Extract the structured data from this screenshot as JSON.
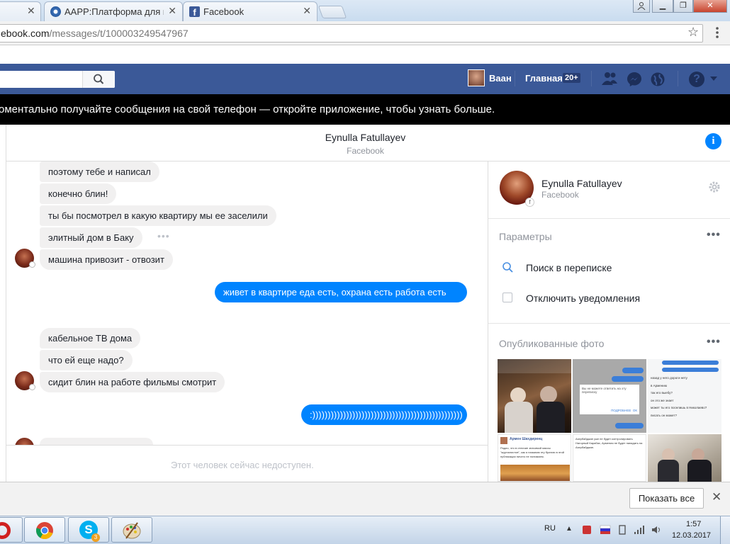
{
  "browser": {
    "tabs": [
      {
        "label": "AAPP:Платформа для м"
      },
      {
        "label": "Facebook"
      }
    ],
    "url_host": "ebook.com",
    "url_path": "/messages/t/100003249547967"
  },
  "fb_nav": {
    "user": "Ваан",
    "home": "Главная",
    "home_badge": "20+",
    "help": "?"
  },
  "banner": {
    "text": "оментально получайте сообщения на свой телефон — откройте приложение, чтобы узнать больше."
  },
  "conversation": {
    "name": "Eynulla Fatullayev",
    "subtitle": "Facebook",
    "messages": [
      {
        "text": "поэтому тебе и написал"
      },
      {
        "text": "конечно блин!"
      },
      {
        "text": "ты бы посмотрел в какую квартиру мы ее заселили"
      },
      {
        "text": "элитный дом в Баку"
      },
      {
        "text": "машина привозит - отвозит"
      },
      {
        "text": "живет в квартире  еда есть, охрана есть работа есть"
      },
      {
        "text": "кабельное ТВ дома"
      },
      {
        "text": "что ей еще надо?"
      },
      {
        "text": "сидит блин на работе фильмы смотрит"
      },
      {
        "text": ":)))))))))))))))))))))))))))))))))))))))))))))))))"
      }
    ],
    "composer_placeholder": "Этот человек сейчас недоступен."
  },
  "sidebar": {
    "name": "Eynulla Fatullayev",
    "subtitle": "Facebook",
    "params_title": "Параметры",
    "search_label": "Поиск в переписке",
    "mute_label": "Отключить уведомления",
    "photos_title": "Опубликованные фото",
    "photo_texts": {
      "p2_dialog": "Вы не можете ответить на эту переписку",
      "p2_btn1": "ПОДРОБНЕЕ",
      "p2_btn2": "ОК",
      "p3_lines": [
        "назад у него дороги нету",
        "в Армению",
        "так его выебу?",
        "он это же знает",
        "может ты его поселишь в Николаево?",
        "писать он может?"
      ],
      "p4_author": "Армен Шахдиренц",
      "p4_text": "Радио, что в отличие значимой массы \"журналистов\", как я называю эту братию в этой публикации ничего не понимаем.",
      "p5_text": "Азербайджан уже не будет контролировать Нагорный Карабах, Армения не будет нападать на Азербайджан."
    }
  },
  "downloads": {
    "show_all": "Показать все"
  },
  "taskbar": {
    "lang": "RU",
    "time": "1:57",
    "date": "12.03.2017",
    "skype_badge": "3"
  },
  "colors": {
    "fb_blue": "#3b5998",
    "messenger_blue": "#0084ff"
  }
}
